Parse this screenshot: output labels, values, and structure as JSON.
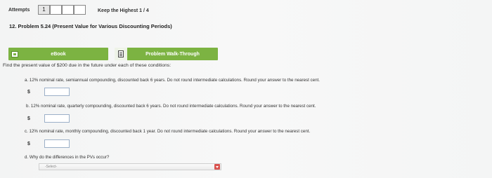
{
  "header": {
    "attempts_label": "Attempts",
    "attempt_boxes": [
      "1",
      "",
      "",
      ""
    ],
    "keep_label": "Keep the Highest 1 / 4"
  },
  "problem": {
    "title": "12. Problem 5.24 (Present Value for Various Discounting Periods)"
  },
  "buttons": {
    "ebook": "eBook",
    "walkthrough": "Problem Walk-Through"
  },
  "prompt": "Find the present value of $200 due in the future under each of these conditions:",
  "questions": [
    {
      "text": "a.  12% nominal rate, semiannual compounding, discounted back 6 years. Do not round intermediate calculations. Round your answer to the nearest cent.",
      "currency": "$",
      "value": ""
    },
    {
      "text": "b.  12% nominal rate, quarterly compounding, discounted back 6 years. Do not round intermediate calculations. Round your answer to the nearest cent.",
      "currency": "$",
      "value": ""
    },
    {
      "text": "c.  12% nominal rate, monthly compounding, discounted back 1 year. Do not round intermediate calculations. Round your answer to the nearest cent.",
      "currency": "$",
      "value": ""
    },
    {
      "text": "d.  Why do the differences in the PVs occur?",
      "select_value": "-Select-"
    }
  ],
  "colors": {
    "button_green": "#7cb342",
    "select_arrow": "#d9534f",
    "input_border": "#9cb0c8"
  },
  "icons": {
    "ebook": "book-icon",
    "walkthrough": "document-icon",
    "dropdown": "chevron-down-icon"
  }
}
